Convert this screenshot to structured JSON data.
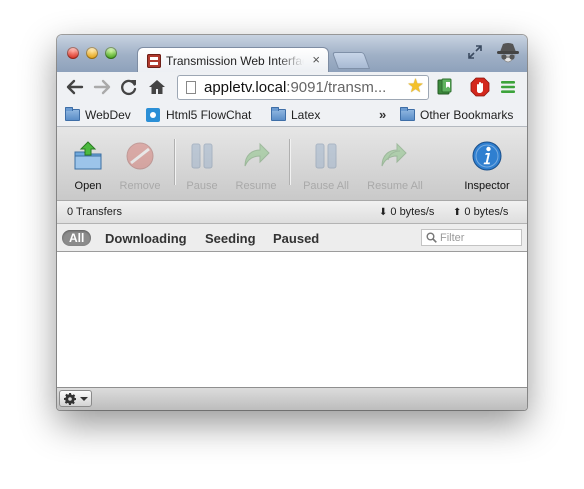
{
  "browser": {
    "tab_title": "Transmission Web Interface",
    "tab_close": "×",
    "url_host": "appletv.local",
    "url_rest": ":9091/transm...",
    "bookmarks": [
      {
        "label": "WebDev",
        "icon": "folder-icon"
      },
      {
        "label": "Html5 FlowChat",
        "icon": "flowchat-icon"
      },
      {
        "label": "Latex",
        "icon": "folder-icon"
      }
    ],
    "bookmarks_overflow": "»",
    "other_bookmarks": "Other Bookmarks"
  },
  "toolbar": {
    "open": "Open",
    "remove": "Remove",
    "pause": "Pause",
    "resume": "Resume",
    "pause_all": "Pause All",
    "resume_all": "Resume All",
    "inspector": "Inspector"
  },
  "status": {
    "transfers": "0 Transfers",
    "download_speed": "0 bytes/s",
    "upload_speed": "0 bytes/s"
  },
  "filter": {
    "tabs": [
      "All",
      "Downloading",
      "Seeding",
      "Paused"
    ],
    "active": "All",
    "placeholder": "Filter"
  },
  "colors": {
    "accent_blue": "#2f7fd0",
    "open_green": "#3fae3a",
    "disabled_gray": "#a9a9a9"
  }
}
